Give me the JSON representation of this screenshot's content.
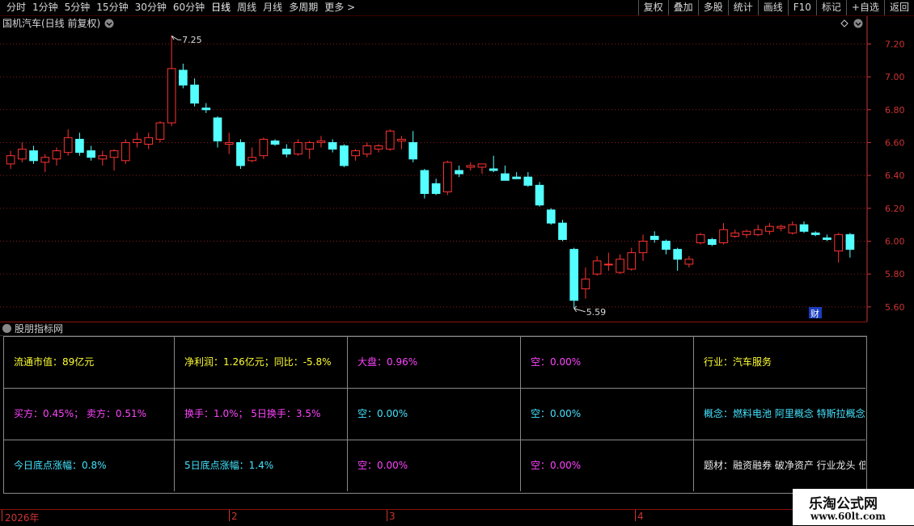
{
  "toolbar": {
    "left_items": [
      "分时",
      "1分钟",
      "5分钟",
      "15分钟",
      "30分钟",
      "60分钟",
      "日线",
      "周线",
      "月线",
      "多周期",
      "更多 >"
    ],
    "right_items": [
      "复权",
      "叠加",
      "多股",
      "统计",
      "画线",
      "F10",
      "标记",
      "+自选",
      "返回"
    ]
  },
  "chart_header": {
    "title": "国机汽车(日线 前复权)",
    "high_label": "7.25",
    "low_label": "5.59",
    "cai_badge": "财"
  },
  "colors": {
    "up": "#ff3232",
    "down": "#54ffff",
    "axis": "#cc3333",
    "grid": "#8a1a1a"
  },
  "chart_data": {
    "type": "candlestick",
    "title": "国机汽车(日线 前复权)",
    "ylim": [
      5.55,
      7.32
    ],
    "yticks": [
      "7.20",
      "7.00",
      "6.80",
      "6.60",
      "6.40",
      "6.20",
      "6.00",
      "5.80",
      "5.60"
    ],
    "ytick_values": [
      7.2,
      7.0,
      6.8,
      6.6,
      6.4,
      6.2,
      6.0,
      5.8,
      5.6
    ],
    "candles": [
      {
        "o": 6.47,
        "h": 6.55,
        "l": 6.44,
        "c": 6.52
      },
      {
        "o": 6.5,
        "h": 6.6,
        "l": 6.48,
        "c": 6.56
      },
      {
        "o": 6.55,
        "h": 6.58,
        "l": 6.47,
        "c": 6.49
      },
      {
        "o": 6.48,
        "h": 6.53,
        "l": 6.42,
        "c": 6.51
      },
      {
        "o": 6.5,
        "h": 6.57,
        "l": 6.46,
        "c": 6.55
      },
      {
        "o": 6.54,
        "h": 6.68,
        "l": 6.52,
        "c": 6.63
      },
      {
        "o": 6.62,
        "h": 6.66,
        "l": 6.52,
        "c": 6.54
      },
      {
        "o": 6.55,
        "h": 6.58,
        "l": 6.49,
        "c": 6.51
      },
      {
        "o": 6.5,
        "h": 6.55,
        "l": 6.46,
        "c": 6.52
      },
      {
        "o": 6.51,
        "h": 6.56,
        "l": 6.43,
        "c": 6.55
      },
      {
        "o": 6.49,
        "h": 6.62,
        "l": 6.47,
        "c": 6.6
      },
      {
        "o": 6.6,
        "h": 6.66,
        "l": 6.57,
        "c": 6.62
      },
      {
        "o": 6.59,
        "h": 6.66,
        "l": 6.56,
        "c": 6.63
      },
      {
        "o": 6.62,
        "h": 6.73,
        "l": 6.6,
        "c": 6.72
      },
      {
        "o": 6.72,
        "h": 7.25,
        "l": 6.7,
        "c": 7.05
      },
      {
        "o": 7.04,
        "h": 7.08,
        "l": 6.93,
        "c": 6.95
      },
      {
        "o": 6.95,
        "h": 6.99,
        "l": 6.82,
        "c": 6.84
      },
      {
        "o": 6.81,
        "h": 6.84,
        "l": 6.78,
        "c": 6.8
      },
      {
        "o": 6.75,
        "h": 6.76,
        "l": 6.57,
        "c": 6.61
      },
      {
        "o": 6.59,
        "h": 6.66,
        "l": 6.53,
        "c": 6.6
      },
      {
        "o": 6.6,
        "h": 6.62,
        "l": 6.44,
        "c": 6.46
      },
      {
        "o": 6.49,
        "h": 6.57,
        "l": 6.48,
        "c": 6.51
      },
      {
        "o": 6.52,
        "h": 6.63,
        "l": 6.5,
        "c": 6.62
      },
      {
        "o": 6.61,
        "h": 6.62,
        "l": 6.58,
        "c": 6.59
      },
      {
        "o": 6.56,
        "h": 6.59,
        "l": 6.51,
        "c": 6.53
      },
      {
        "o": 6.53,
        "h": 6.62,
        "l": 6.52,
        "c": 6.6
      },
      {
        "o": 6.56,
        "h": 6.61,
        "l": 6.5,
        "c": 6.6
      },
      {
        "o": 6.6,
        "h": 6.64,
        "l": 6.57,
        "c": 6.61
      },
      {
        "o": 6.6,
        "h": 6.62,
        "l": 6.54,
        "c": 6.56
      },
      {
        "o": 6.58,
        "h": 6.59,
        "l": 6.45,
        "c": 6.46
      },
      {
        "o": 6.52,
        "h": 6.56,
        "l": 6.49,
        "c": 6.55
      },
      {
        "o": 6.53,
        "h": 6.6,
        "l": 6.51,
        "c": 6.58
      },
      {
        "o": 6.56,
        "h": 6.59,
        "l": 6.54,
        "c": 6.58
      },
      {
        "o": 6.56,
        "h": 6.68,
        "l": 6.55,
        "c": 6.67
      },
      {
        "o": 6.61,
        "h": 6.64,
        "l": 6.56,
        "c": 6.62
      },
      {
        "o": 6.6,
        "h": 6.67,
        "l": 6.48,
        "c": 6.5
      },
      {
        "o": 6.43,
        "h": 6.44,
        "l": 6.26,
        "c": 6.29
      },
      {
        "o": 6.35,
        "h": 6.38,
        "l": 6.28,
        "c": 6.29
      },
      {
        "o": 6.3,
        "h": 6.49,
        "l": 6.28,
        "c": 6.48
      },
      {
        "o": 6.43,
        "h": 6.46,
        "l": 6.39,
        "c": 6.41
      },
      {
        "o": 6.45,
        "h": 6.48,
        "l": 6.43,
        "c": 6.46
      },
      {
        "o": 6.45,
        "h": 6.47,
        "l": 6.41,
        "c": 6.47
      },
      {
        "o": 6.44,
        "h": 6.52,
        "l": 6.42,
        "c": 6.43
      },
      {
        "o": 6.41,
        "h": 6.46,
        "l": 6.38,
        "c": 6.37
      },
      {
        "o": 6.39,
        "h": 6.42,
        "l": 6.38,
        "c": 6.38
      },
      {
        "o": 6.39,
        "h": 6.42,
        "l": 6.33,
        "c": 6.34
      },
      {
        "o": 6.34,
        "h": 6.36,
        "l": 6.21,
        "c": 6.22
      },
      {
        "o": 6.19,
        "h": 6.2,
        "l": 6.1,
        "c": 6.11
      },
      {
        "o": 6.11,
        "h": 6.13,
        "l": 6.0,
        "c": 6.01
      },
      {
        "o": 5.95,
        "h": 5.96,
        "l": 5.59,
        "c": 5.64
      },
      {
        "o": 5.71,
        "h": 5.84,
        "l": 5.65,
        "c": 5.77
      },
      {
        "o": 5.8,
        "h": 5.91,
        "l": 5.79,
        "c": 5.88
      },
      {
        "o": 5.86,
        "h": 5.93,
        "l": 5.82,
        "c": 5.86
      },
      {
        "o": 5.81,
        "h": 5.92,
        "l": 5.8,
        "c": 5.89
      },
      {
        "o": 5.83,
        "h": 5.96,
        "l": 5.82,
        "c": 5.93
      },
      {
        "o": 5.93,
        "h": 6.04,
        "l": 5.88,
        "c": 6.0
      },
      {
        "o": 6.03,
        "h": 6.06,
        "l": 5.99,
        "c": 6.01
      },
      {
        "o": 6.0,
        "h": 6.01,
        "l": 5.92,
        "c": 5.95
      },
      {
        "o": 5.95,
        "h": 5.96,
        "l": 5.82,
        "c": 5.89
      },
      {
        "o": 5.86,
        "h": 5.91,
        "l": 5.84,
        "c": 5.89
      },
      {
        "o": 5.99,
        "h": 6.05,
        "l": 5.98,
        "c": 6.04
      },
      {
        "o": 6.01,
        "h": 6.02,
        "l": 5.97,
        "c": 5.98
      },
      {
        "o": 5.99,
        "h": 6.11,
        "l": 5.98,
        "c": 6.07
      },
      {
        "o": 6.03,
        "h": 6.07,
        "l": 6.02,
        "c": 6.05
      },
      {
        "o": 6.04,
        "h": 6.07,
        "l": 6.02,
        "c": 6.06
      },
      {
        "o": 6.04,
        "h": 6.1,
        "l": 6.03,
        "c": 6.07
      },
      {
        "o": 6.06,
        "h": 6.11,
        "l": 6.04,
        "c": 6.09
      },
      {
        "o": 6.08,
        "h": 6.1,
        "l": 6.06,
        "c": 6.09
      },
      {
        "o": 6.05,
        "h": 6.12,
        "l": 6.04,
        "c": 6.1
      },
      {
        "o": 6.1,
        "h": 6.12,
        "l": 6.05,
        "c": 6.06
      },
      {
        "o": 6.05,
        "h": 6.06,
        "l": 6.03,
        "c": 6.04
      },
      {
        "o": 6.02,
        "h": 6.04,
        "l": 6.0,
        "c": 6.01
      },
      {
        "o": 5.94,
        "h": 6.05,
        "l": 5.87,
        "c": 6.04
      },
      {
        "o": 6.04,
        "h": 6.05,
        "l": 5.9,
        "c": 5.95
      }
    ]
  },
  "indicator_panel": {
    "title": "股朋指标网",
    "cells": [
      {
        "text": "流通市值：89亿元",
        "color": "yellow"
      },
      {
        "text": "净利润：1.26亿元；同比：-5.8%",
        "color": "yellow"
      },
      {
        "text": "大盘：0.96%",
        "color": "magenta"
      },
      {
        "text": "空：0.00%",
        "color": "magenta"
      },
      {
        "text": "行业：汽车服务",
        "color": "yellow"
      },
      {
        "text": "买方：0.45%；  卖方：0.51%",
        "color": "magenta"
      },
      {
        "text": "换手：1.0%；  5日换手：3.5%",
        "color": "magenta"
      },
      {
        "text": "空：0.00%",
        "color": "cyan"
      },
      {
        "text": "空：0.00%",
        "color": "cyan"
      },
      {
        "text": "概念：燃料电池 阿里概念 特斯拉概念",
        "color": "cyan"
      },
      {
        "text": "今日底点涨幅：0.8%",
        "color": "cyan"
      },
      {
        "text": "5日底点涨幅：1.4%",
        "color": "cyan"
      },
      {
        "text": "空：0.00%",
        "color": "magenta"
      },
      {
        "text": "空：0.00%",
        "color": "magenta"
      },
      {
        "text": "题材：融资融券 破净资产 行业龙头 低",
        "color": "white"
      }
    ]
  },
  "date_axis": {
    "labels": [
      "2026年",
      "2",
      "3",
      "4"
    ]
  },
  "watermark": {
    "line1": "乐淘公式网",
    "line2": "www.60lt.com"
  }
}
